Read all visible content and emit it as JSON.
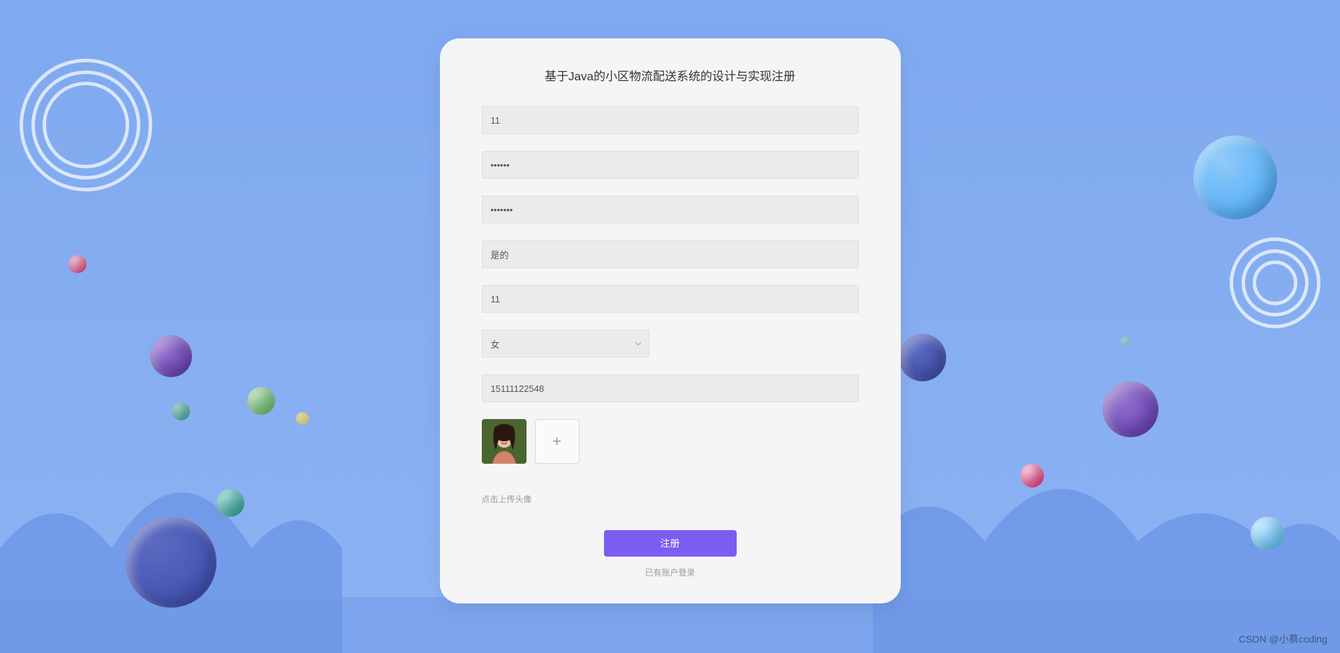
{
  "title": "基于Java的小区物流配送系统的设计与实现注册",
  "fields": {
    "username": {
      "value": "11"
    },
    "password": {
      "value": "••••••"
    },
    "password_confirm": {
      "value": "•••••••"
    },
    "realname": {
      "value": "是的"
    },
    "age": {
      "value": "11"
    },
    "gender": {
      "selected": "女"
    },
    "phone": {
      "value": "15111122548"
    }
  },
  "upload_hint": "点击上传头像",
  "submit_label": "注册",
  "login_link": "已有账户登录",
  "watermark": "CSDN @小蔡coding",
  "colors": {
    "accent": "#7c5cf2",
    "bg_sky": "#8cb3f2"
  }
}
